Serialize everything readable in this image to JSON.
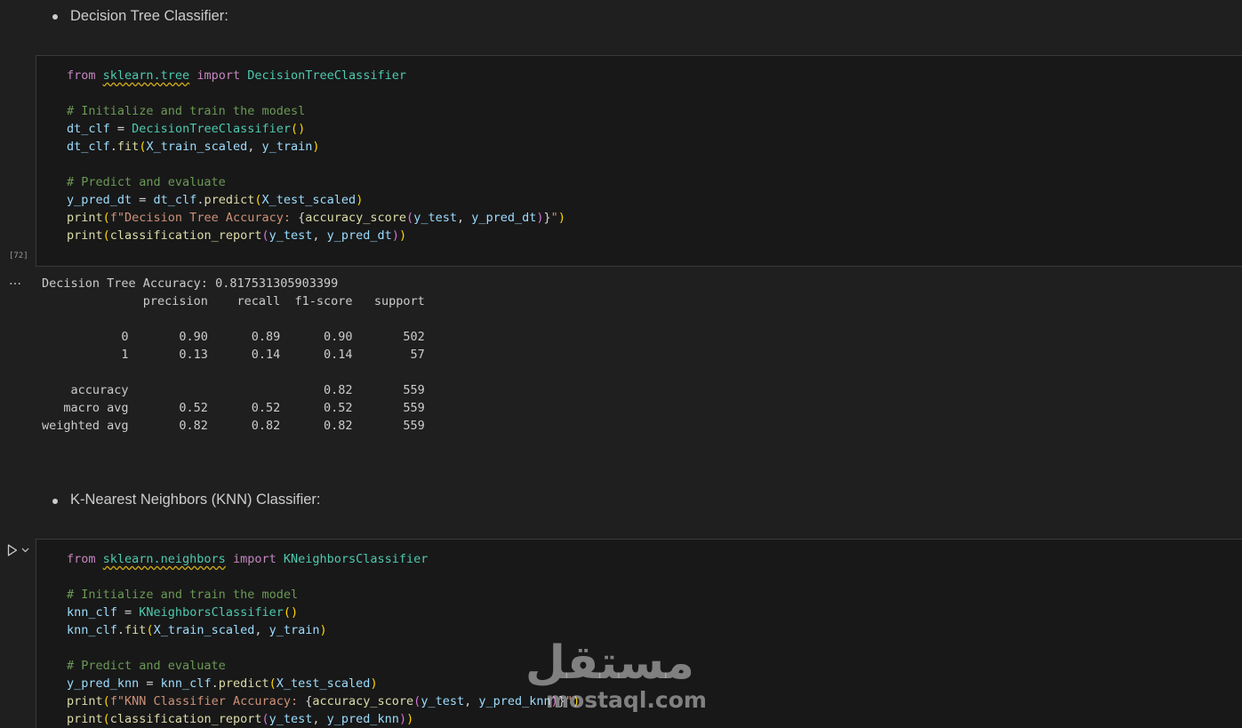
{
  "markdown": [
    {
      "text": "Decision Tree Classifier:"
    },
    {
      "text": "K-Nearest Neighbors (KNN) Classifier:"
    }
  ],
  "cells": [
    {
      "execution_count": "[72]",
      "code": [
        [
          [
            "kw",
            "from "
          ],
          [
            "mod",
            "sklearn.tree"
          ],
          [
            "kw",
            " import "
          ],
          [
            "cls",
            "DecisionTreeClassifier"
          ]
        ],
        [],
        [
          [
            "cm",
            "# Initialize and train the modesl"
          ]
        ],
        [
          [
            "var",
            "dt_clf"
          ],
          [
            "",
            "  = "
          ],
          [
            "cls",
            "DecisionTreeClassifier"
          ],
          [
            "p1",
            "()"
          ]
        ],
        [
          [
            "var",
            "dt_clf"
          ],
          [
            "",
            "."
          ],
          [
            "fn",
            "fit"
          ],
          [
            "p1",
            "("
          ],
          [
            "var",
            "X_train_scaled"
          ],
          [
            "",
            ", "
          ],
          [
            "var",
            "y_train"
          ],
          [
            "p1",
            ")"
          ]
        ],
        [],
        [
          [
            "cm",
            "# Predict and evaluate"
          ]
        ],
        [
          [
            "var",
            "y_pred_dt"
          ],
          [
            "",
            " = "
          ],
          [
            "var",
            "dt_clf"
          ],
          [
            "",
            "."
          ],
          [
            "fn",
            "predict"
          ],
          [
            "p1",
            "("
          ],
          [
            "var",
            "X_test_scaled"
          ],
          [
            "p1",
            ")"
          ]
        ],
        [
          [
            "fn",
            "print"
          ],
          [
            "p1",
            "("
          ],
          [
            "str",
            "f\"Decision Tree Accuracy: "
          ],
          [
            "",
            "{"
          ],
          [
            "fn",
            "accuracy_score"
          ],
          [
            "p2",
            "("
          ],
          [
            "var",
            "y_test"
          ],
          [
            "",
            ", "
          ],
          [
            "var",
            "y_pred_dt"
          ],
          [
            "p2",
            ")"
          ],
          [
            "",
            "}"
          ],
          [
            "str",
            "\""
          ],
          [
            "p1",
            ")"
          ]
        ],
        [
          [
            "fn",
            "print"
          ],
          [
            "p1",
            "("
          ],
          [
            "fn",
            "classification_report"
          ],
          [
            "p2",
            "("
          ],
          [
            "var",
            "y_test"
          ],
          [
            "",
            ", "
          ],
          [
            "var",
            "y_pred_dt"
          ],
          [
            "p2",
            ")"
          ],
          [
            "p1",
            ")"
          ]
        ]
      ]
    },
    {
      "run_label": "Run cell",
      "code": [
        [
          [
            "kw",
            "from "
          ],
          [
            "mod",
            "sklearn.neighbors"
          ],
          [
            "kw",
            " import "
          ],
          [
            "cls",
            "KNeighborsClassifier"
          ]
        ],
        [],
        [
          [
            "cm",
            "# Initialize and train the model"
          ]
        ],
        [
          [
            "var",
            "knn_clf"
          ],
          [
            "",
            " = "
          ],
          [
            "cls",
            "KNeighborsClassifier"
          ],
          [
            "p1",
            "()"
          ]
        ],
        [
          [
            "var",
            "knn_clf"
          ],
          [
            "",
            "."
          ],
          [
            "fn",
            "fit"
          ],
          [
            "p1",
            "("
          ],
          [
            "var",
            "X_train_scaled"
          ],
          [
            "",
            ", "
          ],
          [
            "var",
            "y_train"
          ],
          [
            "p1",
            ")"
          ]
        ],
        [],
        [
          [
            "cm",
            "# Predict and evaluate"
          ]
        ],
        [
          [
            "var",
            "y_pred_knn"
          ],
          [
            "",
            " = "
          ],
          [
            "var",
            "knn_clf"
          ],
          [
            "",
            "."
          ],
          [
            "fn",
            "predict"
          ],
          [
            "p1",
            "("
          ],
          [
            "var",
            "X_test_scaled"
          ],
          [
            "p1",
            ")"
          ]
        ],
        [
          [
            "fn",
            "print"
          ],
          [
            "p1",
            "("
          ],
          [
            "str",
            "f\"KNN Classifier Accuracy: "
          ],
          [
            "",
            "{"
          ],
          [
            "fn",
            "accuracy_score"
          ],
          [
            "p2",
            "("
          ],
          [
            "var",
            "y_test"
          ],
          [
            "",
            ", "
          ],
          [
            "var",
            "y_pred_knn"
          ],
          [
            "p2",
            ")"
          ],
          [
            "",
            "}"
          ],
          [
            "str",
            "\""
          ],
          [
            "p1",
            ")"
          ]
        ],
        [
          [
            "fn",
            "print"
          ],
          [
            "p1",
            "("
          ],
          [
            "fn",
            "classification_report"
          ],
          [
            "p2",
            "("
          ],
          [
            "var",
            "y_test"
          ],
          [
            "",
            ", "
          ],
          [
            "var",
            "y_pred_knn"
          ],
          [
            "p2",
            ")"
          ],
          [
            "p1",
            ")"
          ]
        ]
      ]
    }
  ],
  "output": {
    "ellipsis": "…",
    "lines": [
      "Decision Tree Accuracy: 0.817531305903399",
      "              precision    recall  f1-score   support",
      "",
      "           0       0.90      0.89      0.90       502",
      "           1       0.13      0.14      0.14        57",
      "",
      "    accuracy                           0.82       559",
      "   macro avg       0.52      0.52      0.52       559",
      "weighted avg       0.82      0.82      0.82       559"
    ]
  },
  "watermark": {
    "arabic": "مستقل",
    "latin": "mostaql.com"
  },
  "colors": {
    "background": "#1f1f1f",
    "cell_background": "#181818",
    "keyword": "#c586c0",
    "class": "#4ec9b0",
    "comment": "#6a9955",
    "function": "#dcdcaa",
    "variable": "#9cdcfe",
    "string": "#ce9178",
    "bracket_1": "#ffd700",
    "bracket_2": "#da70d6"
  }
}
